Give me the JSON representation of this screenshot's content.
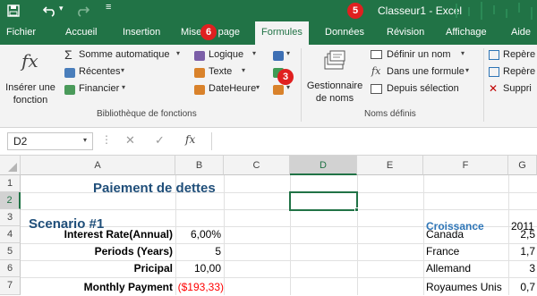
{
  "titlebar": {
    "title": "Classeur1  -  Excel"
  },
  "tabs": [
    "Fichier",
    "Accueil",
    "Insertion",
    "Mise en page",
    "Formules",
    "Données",
    "Révision",
    "Affichage",
    "Aide"
  ],
  "ribbon": {
    "insert_function_line1": "Insérer une",
    "insert_function_line2": "fonction",
    "autosum": "Somme automatique",
    "recent": "Récentes",
    "financial": "Financier",
    "logical": "Logique",
    "text": "Texte",
    "datetime": "DateHeure",
    "name_manager_line1": "Gestionnaire",
    "name_manager_line2": "de noms",
    "define_name": "Définir un nom",
    "use_in_formula": "Dans une formule",
    "create_from_selection": "Depuis sélection",
    "trace_precedents": "Repère",
    "trace_dependents": "Repère",
    "remove_arrows": "Suppri",
    "group_library": "Bibliothèque de fonctions",
    "group_names": "Noms définis"
  },
  "formula_bar": {
    "name_box": "D2",
    "fx": "fx",
    "value": ""
  },
  "badges": {
    "b3": "3",
    "b5": "5",
    "b6": "6"
  },
  "columns": [
    "A",
    "B",
    "C",
    "D",
    "E",
    "F",
    "G"
  ],
  "rows": [
    "1",
    "2",
    "3",
    "4",
    "5",
    "6",
    "7"
  ],
  "cells": {
    "title": "Paiement de dettes",
    "scenario": "Scenario #1",
    "interest_label": "Interest Rate(Annual)",
    "interest_value": "6,00%",
    "periods_label": "Periods (Years)",
    "periods_value": "5",
    "principal_label": "Pricipal",
    "principal_value": "10,00",
    "payment_label": "Monthly Payment",
    "payment_value": "($193,33)",
    "growth_header": "Croissance",
    "year_header": "2011",
    "countries": [
      "Canada",
      "France",
      "Allemand",
      "Royaumes Unis"
    ],
    "growth_values": [
      "2,5",
      "1,7",
      "3",
      "0,7"
    ]
  },
  "colors": {
    "excel_green": "#217346",
    "header_blue": "#2e75b6",
    "negative_red": "#ff0000",
    "badge_red": "#e02020"
  }
}
